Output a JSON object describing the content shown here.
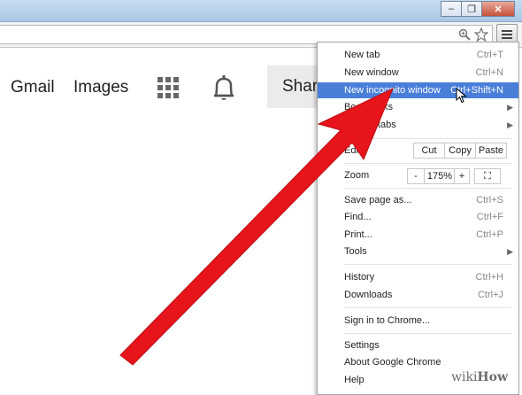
{
  "window": {
    "minimize_glyph": "–",
    "restore_glyph": "❐",
    "close_glyph": "✕"
  },
  "toolbar": {
    "zoom_icon": "magnifier-icon",
    "star_icon": "star-icon",
    "menu_icon": "hamburger-menu-icon"
  },
  "google_bar": {
    "gmail": "Gmail",
    "images": "Images",
    "share": "Share"
  },
  "menu": {
    "new_tab": {
      "label": "New tab",
      "shortcut": "Ctrl+T"
    },
    "new_window": {
      "label": "New window",
      "shortcut": "Ctrl+N"
    },
    "new_incognito": {
      "label": "New incognito window",
      "shortcut": "Ctrl+Shift+N"
    },
    "bookmarks": {
      "label": "Bookmarks"
    },
    "recent_tabs": {
      "label": "Recent tabs"
    },
    "edit": {
      "label": "Edit",
      "cut": "Cut",
      "copy": "Copy",
      "paste": "Paste"
    },
    "zoom": {
      "label": "Zoom",
      "minus": "-",
      "value": "175%",
      "plus": "+",
      "fullscreen_glyph": "⛶"
    },
    "save_page": {
      "label": "Save page as...",
      "shortcut": "Ctrl+S"
    },
    "find": {
      "label": "Find...",
      "shortcut": "Ctrl+F"
    },
    "print": {
      "label": "Print...",
      "shortcut": "Ctrl+P"
    },
    "tools": {
      "label": "Tools"
    },
    "history": {
      "label": "History",
      "shortcut": "Ctrl+H"
    },
    "downloads": {
      "label": "Downloads",
      "shortcut": "Ctrl+J"
    },
    "sign_in": {
      "label": "Sign in to Chrome..."
    },
    "settings": {
      "label": "Settings"
    },
    "about": {
      "label": "About Google Chrome"
    },
    "help": {
      "label": "Help"
    },
    "submenu_arrow": "▶"
  },
  "watermark": {
    "wiki": "wiki",
    "how": "How"
  },
  "colors": {
    "highlight": "#4a7fd9",
    "annotation_arrow": "#e8141c"
  }
}
